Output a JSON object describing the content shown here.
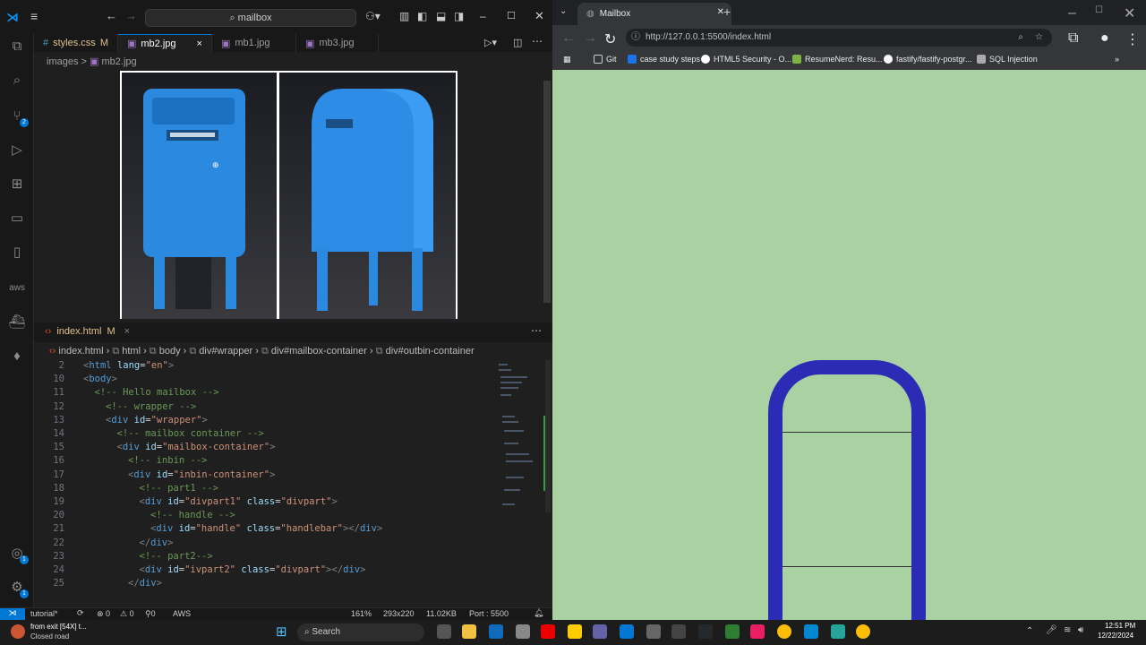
{
  "vscode": {
    "search_label": "mailbox",
    "tabs": [
      {
        "label": "styles.css",
        "status": "M",
        "icon": "#"
      },
      {
        "label": "mb2.jpg",
        "close": "×"
      },
      {
        "label": "mb1.jpg"
      },
      {
        "label": "mb3.jpg"
      }
    ],
    "image_breadcrumb": {
      "folder": "images",
      "sep": ">",
      "file": "mb2.jpg"
    },
    "editor_tab": {
      "label": "index.html",
      "status": "M",
      "close": "×"
    },
    "code_breadcrumb": [
      "index.html",
      "html",
      "body",
      "div#wrapper",
      "div#mailbox-container",
      "div#outbin-container"
    ],
    "code_lines": [
      {
        "n": "2",
        "indent": 0,
        "parts": [
          [
            "pn",
            "<"
          ],
          [
            "tg",
            "html"
          ],
          [
            "at",
            " lang"
          ],
          [
            "pl",
            "="
          ],
          [
            "st",
            "\"en\""
          ],
          [
            "pn",
            ">"
          ]
        ]
      },
      {
        "n": "10",
        "indent": 0,
        "parts": [
          [
            "pn",
            "<"
          ],
          [
            "tg",
            "body"
          ],
          [
            "pn",
            ">"
          ]
        ]
      },
      {
        "n": "11",
        "indent": 1,
        "parts": [
          [
            "cm",
            "<!-- Hello mailbox -->"
          ]
        ]
      },
      {
        "n": "12",
        "indent": 2,
        "parts": [
          [
            "cm",
            "<!-- wrapper -->"
          ]
        ]
      },
      {
        "n": "13",
        "indent": 2,
        "parts": [
          [
            "pn",
            "<"
          ],
          [
            "tg",
            "div"
          ],
          [
            "at",
            " id"
          ],
          [
            "pl",
            "="
          ],
          [
            "st",
            "\"wrapper\""
          ],
          [
            "pn",
            ">"
          ]
        ]
      },
      {
        "n": "14",
        "indent": 3,
        "parts": [
          [
            "cm",
            "<!-- mailbox container -->"
          ]
        ]
      },
      {
        "n": "15",
        "indent": 3,
        "parts": [
          [
            "pn",
            "<"
          ],
          [
            "tg",
            "div"
          ],
          [
            "at",
            " id"
          ],
          [
            "pl",
            "="
          ],
          [
            "st",
            "\"mailbox-container\""
          ],
          [
            "pn",
            ">"
          ]
        ]
      },
      {
        "n": "16",
        "indent": 4,
        "parts": [
          [
            "cm",
            "<!-- inbin -->"
          ]
        ]
      },
      {
        "n": "17",
        "indent": 4,
        "parts": [
          [
            "pn",
            "<"
          ],
          [
            "tg",
            "div"
          ],
          [
            "at",
            " id"
          ],
          [
            "pl",
            "="
          ],
          [
            "st",
            "\"inbin-container\""
          ],
          [
            "pn",
            ">"
          ]
        ]
      },
      {
        "n": "18",
        "indent": 5,
        "parts": [
          [
            "cm",
            "<!-- part1 -->"
          ]
        ]
      },
      {
        "n": "19",
        "indent": 5,
        "parts": [
          [
            "pn",
            "<"
          ],
          [
            "tg",
            "div"
          ],
          [
            "at",
            " id"
          ],
          [
            "pl",
            "="
          ],
          [
            "st",
            "\"divpart1\""
          ],
          [
            "at",
            " class"
          ],
          [
            "pl",
            "="
          ],
          [
            "st",
            "\"divpart\""
          ],
          [
            "pn",
            ">"
          ]
        ]
      },
      {
        "n": "20",
        "indent": 6,
        "parts": [
          [
            "cm",
            "<!-- handle -->"
          ]
        ]
      },
      {
        "n": "21",
        "indent": 6,
        "parts": [
          [
            "pn",
            "<"
          ],
          [
            "tg",
            "div"
          ],
          [
            "at",
            " id"
          ],
          [
            "pl",
            "="
          ],
          [
            "st",
            "\"handle\""
          ],
          [
            "at",
            " class"
          ],
          [
            "pl",
            "="
          ],
          [
            "st",
            "\"handlebar\""
          ],
          [
            "pn",
            "></"
          ],
          [
            "tg",
            "div"
          ],
          [
            "pn",
            ">"
          ]
        ]
      },
      {
        "n": "22",
        "indent": 5,
        "parts": [
          [
            "pn",
            "</"
          ],
          [
            "tg",
            "div"
          ],
          [
            "pn",
            ">"
          ]
        ]
      },
      {
        "n": "23",
        "indent": 5,
        "parts": [
          [
            "cm",
            "<!-- part2-->"
          ]
        ]
      },
      {
        "n": "24",
        "indent": 5,
        "parts": [
          [
            "pn",
            "<"
          ],
          [
            "tg",
            "div"
          ],
          [
            "at",
            " id"
          ],
          [
            "pl",
            "="
          ],
          [
            "st",
            "\"ivpart2\""
          ],
          [
            "at",
            " class"
          ],
          [
            "pl",
            "="
          ],
          [
            "st",
            "\"divpart\""
          ],
          [
            "pn",
            "></"
          ],
          [
            "tg",
            "div"
          ],
          [
            "pn",
            ">"
          ]
        ]
      },
      {
        "n": "25",
        "indent": 4,
        "parts": [
          [
            "pn",
            "</"
          ],
          [
            "tg",
            "div"
          ],
          [
            "pn",
            ">"
          ]
        ]
      }
    ],
    "status": {
      "branch": "tutorial*",
      "errors": "⊗ 0",
      "warnings": "⚠ 0",
      "ports": "⚲0",
      "aws": "AWS",
      "zoom": "161%",
      "dimensions": "293x220",
      "size": "11.02KB",
      "port": "Port : 5500"
    }
  },
  "browser": {
    "tab_title": "Mailbox",
    "url_host": "http://127.0.0.1",
    "url_path": ":5500/index.html",
    "bookmarks": [
      "Git",
      "case study steps",
      "HTML5 Security - O...",
      "ResumeNerd: Resu...",
      "fastify/fastify-postgr...",
      "SQL Injection"
    ]
  },
  "taskbar": {
    "notification_title": "from exit [54X] t...",
    "notification_sub": "Closed road",
    "search_label": "Search",
    "time": "12:51 PM",
    "date": "12/22/2024"
  },
  "colors": {
    "page_bg": "#aad1a1",
    "mailbox_stroke": "#2b2bb6",
    "vscode_accent": "#0078d4"
  }
}
